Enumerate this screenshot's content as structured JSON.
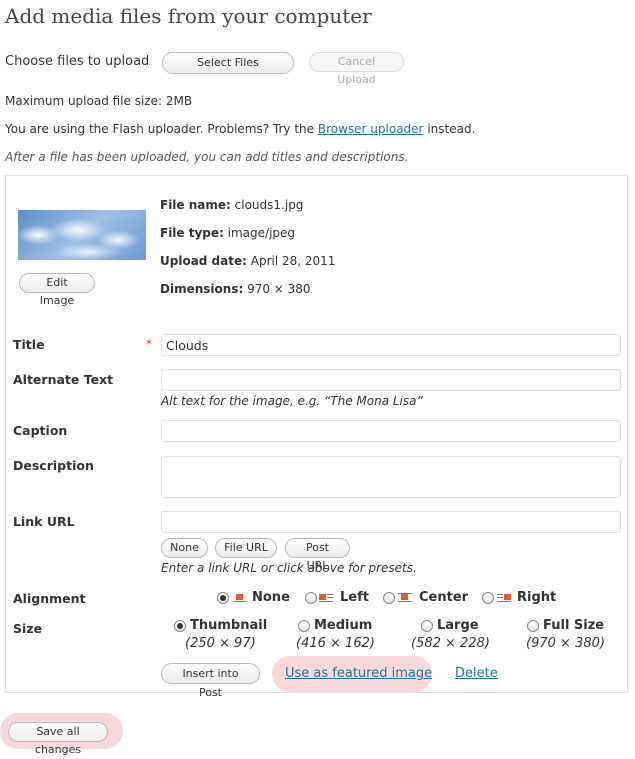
{
  "page_title": "Add media files from your computer",
  "upload": {
    "choose_label": "Choose files to upload",
    "select_button": "Select Files",
    "cancel_button": "Cancel Upload",
    "max_size": "Maximum upload file size: 2MB",
    "flash_text_before": "You are using the Flash uploader. Problems? Try the ",
    "browser_link": "Browser uploader",
    "flash_text_after": " instead.",
    "after_note": "After a file has been uploaded, you can add titles and descriptions."
  },
  "file": {
    "edit_image_button": "Edit Image",
    "name_label": "File name:",
    "name_value": "clouds1.jpg",
    "type_label": "File type:",
    "type_value": "image/jpeg",
    "date_label": "Upload date:",
    "date_value": "April 28, 2011",
    "dim_label": "Dimensions:",
    "dim_value": "970 × 380"
  },
  "fields": {
    "title_label": "Title",
    "required_mark": "*",
    "title_value": "Clouds",
    "alt_label": "Alternate Text",
    "alt_value": "",
    "alt_help": "Alt text for the image, e.g. “The Mona Lisa”",
    "caption_label": "Caption",
    "caption_value": "",
    "description_label": "Description",
    "description_value": "",
    "link_label": "Link URL",
    "link_value": "",
    "link_buttons": [
      "None",
      "File URL",
      "Post URL"
    ],
    "link_help": "Enter a link URL or click above for presets."
  },
  "alignment": {
    "label": "Alignment",
    "options": [
      "None",
      "Left",
      "Center",
      "Right"
    ],
    "selected": "None"
  },
  "size": {
    "label": "Size",
    "options": [
      {
        "name": "Thumbnail",
        "dims": "(250 × 97)"
      },
      {
        "name": "Medium",
        "dims": "(416 × 162)"
      },
      {
        "name": "Large",
        "dims": "(582 × 228)"
      },
      {
        "name": "Full Size",
        "dims": "(970 × 380)"
      }
    ],
    "selected": "Thumbnail"
  },
  "actions": {
    "insert_button": "Insert into Post",
    "featured_link": "Use as featured image",
    "delete_link": "Delete",
    "save_all_button": "Save all changes"
  },
  "colors": {
    "link": "#21759b",
    "highlight": "#f9d8dc",
    "required": "#d54e21"
  }
}
